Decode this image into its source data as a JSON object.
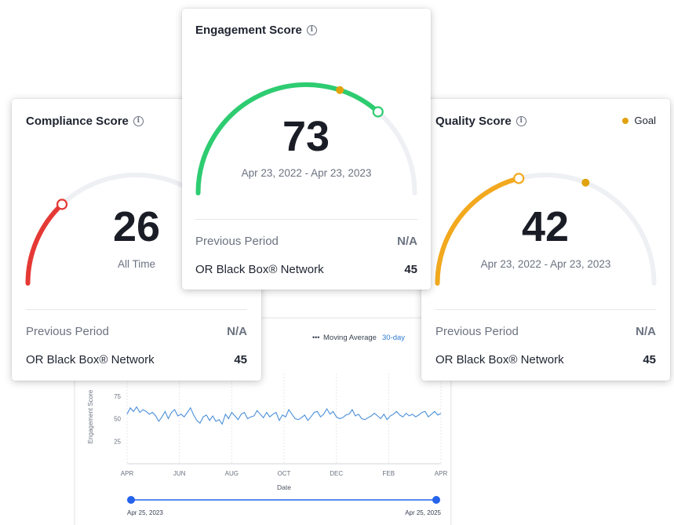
{
  "compliance": {
    "title": "Compliance Score",
    "score": "26",
    "period": "All Time",
    "previous_label": "Previous Period",
    "previous_value": "N/A",
    "network_label": "OR Black Box® Network",
    "network_value": "45",
    "score_value": 26,
    "goal_value": 73,
    "color": "#e53935"
  },
  "engagement": {
    "title": "Engagement Score",
    "score": "73",
    "period": "Apr 23, 2022 - Apr 23, 2023",
    "previous_label": "Previous Period",
    "previous_value": "N/A",
    "network_label": "OR Black Box® Network",
    "network_value": "45",
    "score_value": 73,
    "goal_value": 60,
    "color": "#2ecc71"
  },
  "quality": {
    "title": "Quality Score",
    "score": "42",
    "period": "Apr 23, 2022 - Apr 23, 2023",
    "previous_label": "Previous Period",
    "previous_value": "N/A",
    "network_label": "OR Black Box® Network",
    "network_value": "45",
    "score_value": 42,
    "goal_value": 62,
    "color": "#f2a91e",
    "legend_goal": "Goal"
  },
  "colors": {
    "goal": "#e0a30c",
    "track": "#eef0f4",
    "line": "#4a8fd8"
  },
  "trend": {
    "legend_label": "Moving Average",
    "range_label": "30-day",
    "ylabel": "Engagement Score",
    "xlabel": "Date",
    "yticks": [
      "75",
      "50",
      "25"
    ],
    "xticks": [
      "APR",
      "JUN",
      "AUG",
      "OCT",
      "DEC",
      "FEB",
      "APR"
    ],
    "start_date": "Apr 25, 2023",
    "end_date": "Apr 25, 2025"
  },
  "chart_data": {
    "type": "line",
    "xlabel": "Date",
    "ylabel": "Engagement Score",
    "ylim": [
      0,
      100
    ],
    "series": [
      {
        "values": [
          55,
          62,
          58,
          63,
          57,
          60,
          58,
          55,
          57,
          53,
          47,
          52,
          58,
          50,
          57,
          60,
          53,
          55,
          52,
          57,
          62,
          54,
          48,
          45,
          52,
          54,
          48,
          53,
          47,
          49,
          44,
          55,
          50,
          57,
          53,
          49,
          55,
          57,
          50,
          52,
          53,
          59,
          55,
          51,
          57,
          52,
          55,
          57,
          48,
          54,
          52,
          60,
          55,
          50,
          49,
          51,
          54,
          48,
          52,
          57,
          58,
          52,
          55,
          61,
          55,
          58,
          52,
          50,
          51,
          54,
          55,
          60,
          53,
          55,
          50,
          49,
          51,
          53,
          56,
          53,
          50,
          55,
          49,
          53,
          55,
          58,
          54,
          52,
          56,
          53,
          55,
          52,
          54,
          57,
          58,
          52,
          55,
          58,
          54,
          56
        ]
      }
    ]
  }
}
